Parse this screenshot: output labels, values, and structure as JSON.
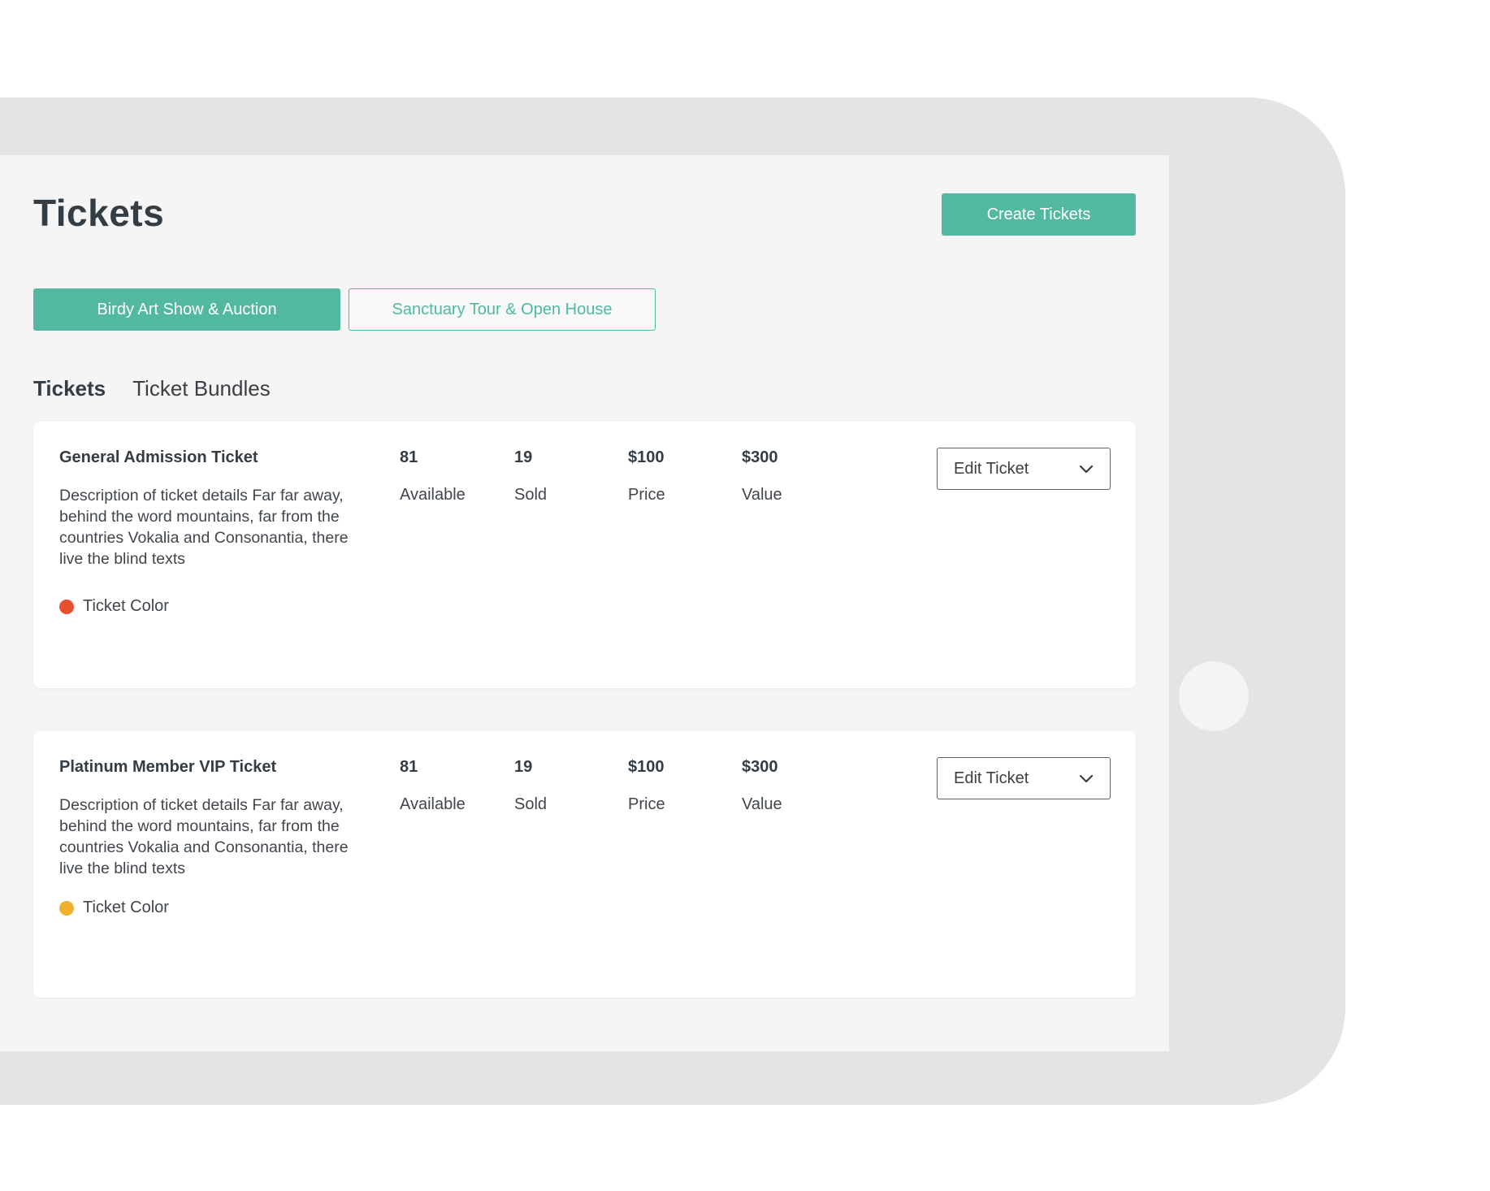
{
  "header": {
    "title": "Tickets",
    "create_button_label": "Create Tickets"
  },
  "events": [
    {
      "label": "Birdy Art Show & Auction",
      "active": true
    },
    {
      "label": "Sanctuary Tour & Open House",
      "active": false
    }
  ],
  "tabs": [
    {
      "label": "Tickets",
      "active": true
    },
    {
      "label": "Ticket Bundles",
      "active": false
    }
  ],
  "tickets": [
    {
      "name": "General Admission Ticket",
      "description": "Description of ticket details Far far away, behind the word mountains, far from the countries Vokalia and Consonantia, there live the blind texts",
      "color_label": "Ticket Color",
      "color": "#e8512f",
      "available": "81",
      "available_label": "Available",
      "sold": "19",
      "sold_label": "Sold",
      "price": "$100",
      "price_label": "Price",
      "value": "$300",
      "value_label": "Value",
      "action_label": "Edit Ticket"
    },
    {
      "name": "Platinum Member VIP Ticket",
      "description": "Description of ticket details Far far away, behind the word mountains, far from the countries Vokalia and Consonantia, there live the blind texts",
      "color_label": "Ticket Color",
      "color": "#efb12f",
      "available": "81",
      "available_label": "Available",
      "sold": "19",
      "sold_label": "Sold",
      "price": "$100",
      "price_label": "Price",
      "value": "$300",
      "value_label": "Value",
      "action_label": "Edit Ticket"
    }
  ],
  "colors": {
    "accent": "#52b9a0",
    "device_frame": "#e4e4e3",
    "screen_bg": "#f5f5f5"
  },
  "icons": {
    "dropdown": "chevron-down-icon"
  }
}
